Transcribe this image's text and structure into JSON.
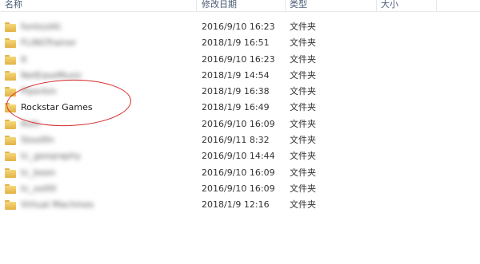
{
  "columns": {
    "name": "名称",
    "date": "修改日期",
    "type": "类型",
    "size": "大小"
  },
  "rows": [
    {
      "name": "fonts(d4)",
      "date": "2016/9/10 16:23",
      "type": "文件夹",
      "blurred": true
    },
    {
      "name": "FLiNGTrainer",
      "date": "2018/1/9 16:51",
      "type": "文件夹",
      "blurred": true
    },
    {
      "name": "It",
      "date": "2016/9/10 16:23",
      "type": "文件夹",
      "blurred": true
    },
    {
      "name": "NetEaseMusic",
      "date": "2018/1/9 14:54",
      "type": "文件夹",
      "blurred": true
    },
    {
      "name": "Piperbin",
      "date": "2018/1/9 16:38",
      "type": "文件夹",
      "blurred": true
    },
    {
      "name": "Rockstar Games",
      "date": "2018/1/9 16:49",
      "type": "文件夹",
      "blurred": false
    },
    {
      "name": "Rsfn",
      "date": "2016/9/10 16:09",
      "type": "文件夹",
      "blurred": true
    },
    {
      "name": "Stos0fn",
      "date": "2016/9/11 8:32",
      "type": "文件夹",
      "blurred": true
    },
    {
      "name": "tc_geoqraphy",
      "date": "2016/9/10 14:44",
      "type": "文件夹",
      "blurred": true
    },
    {
      "name": "tc_been",
      "date": "2016/9/10 16:09",
      "type": "文件夹",
      "blurred": true
    },
    {
      "name": "tc_oolllll",
      "date": "2016/9/10 16:09",
      "type": "文件夹",
      "blurred": true
    },
    {
      "name": "Virtual Machines",
      "date": "2018/1/9 12:16",
      "type": "文件夹",
      "blurred": true
    }
  ],
  "colors": {
    "folder": "#e8c15a",
    "highlight_circle": "#d62a2a",
    "header_text": "#4a5a74"
  },
  "icons": {
    "row": "folder-icon"
  }
}
